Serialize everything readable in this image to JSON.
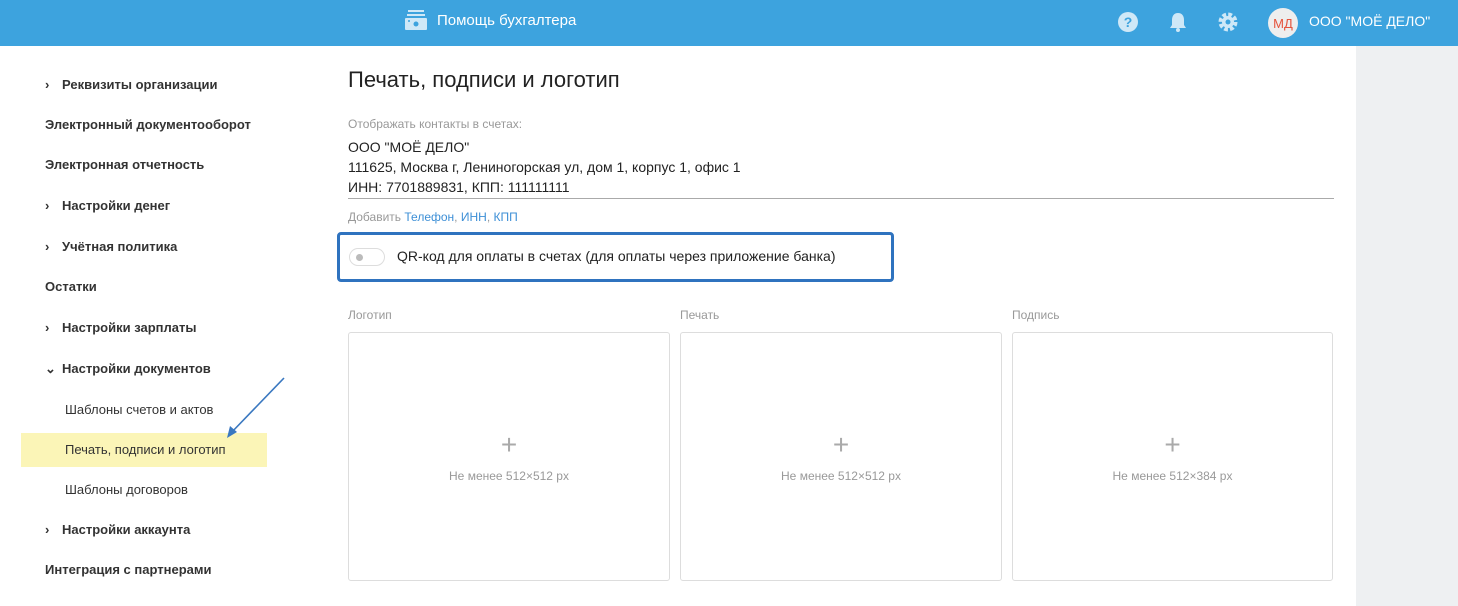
{
  "header": {
    "title": "Помощь бухгалтера",
    "avatar_initials": "МД",
    "org_name": "ООО \"МОЁ ДЕЛО\""
  },
  "sidebar": {
    "items": [
      {
        "label": "Реквизиты организации",
        "chevron": "›"
      },
      {
        "label": "Электронный документооборот"
      },
      {
        "label": "Электронная отчетность"
      },
      {
        "label": "Настройки денег",
        "chevron": "›"
      },
      {
        "label": "Учётная политика",
        "chevron": "›"
      },
      {
        "label": "Остатки"
      },
      {
        "label": "Настройки зарплаты",
        "chevron": "›"
      },
      {
        "label": "Настройки документов",
        "chevron": "⌄"
      },
      {
        "label": "Шаблоны счетов и актов"
      },
      {
        "label": "Печать, подписи и логотип"
      },
      {
        "label": "Шаблоны договоров"
      },
      {
        "label": "Настройки аккаунта",
        "chevron": "›"
      },
      {
        "label": "Интеграция с партнерами"
      }
    ]
  },
  "main": {
    "title": "Печать, подписи и логотип",
    "contacts_label": "Отображать контакты в счетах:",
    "contacts": [
      "ООО \"МОЁ ДЕЛО\"",
      "111625, Москва г, Лениногорская ул, дом 1, корпус 1, офис 1",
      "ИНН: 7701889831, КПП: 111111111"
    ],
    "add_prefix": "Добавить",
    "add_links": [
      "Телефон",
      ", ",
      "ИНН",
      ", ",
      "КПП"
    ],
    "qr_label": "QR-код для оплаты в счетах (для оплаты через приложение банка)",
    "qr_enabled": false,
    "uploads": [
      {
        "label": "Логотип",
        "plus": "+",
        "hint": "Не менее 512×512 px"
      },
      {
        "label": "Печать",
        "plus": "+",
        "hint": "Не менее 512×512 px"
      },
      {
        "label": "Подпись",
        "plus": "+",
        "hint": "Не менее 512×384 px"
      }
    ]
  }
}
